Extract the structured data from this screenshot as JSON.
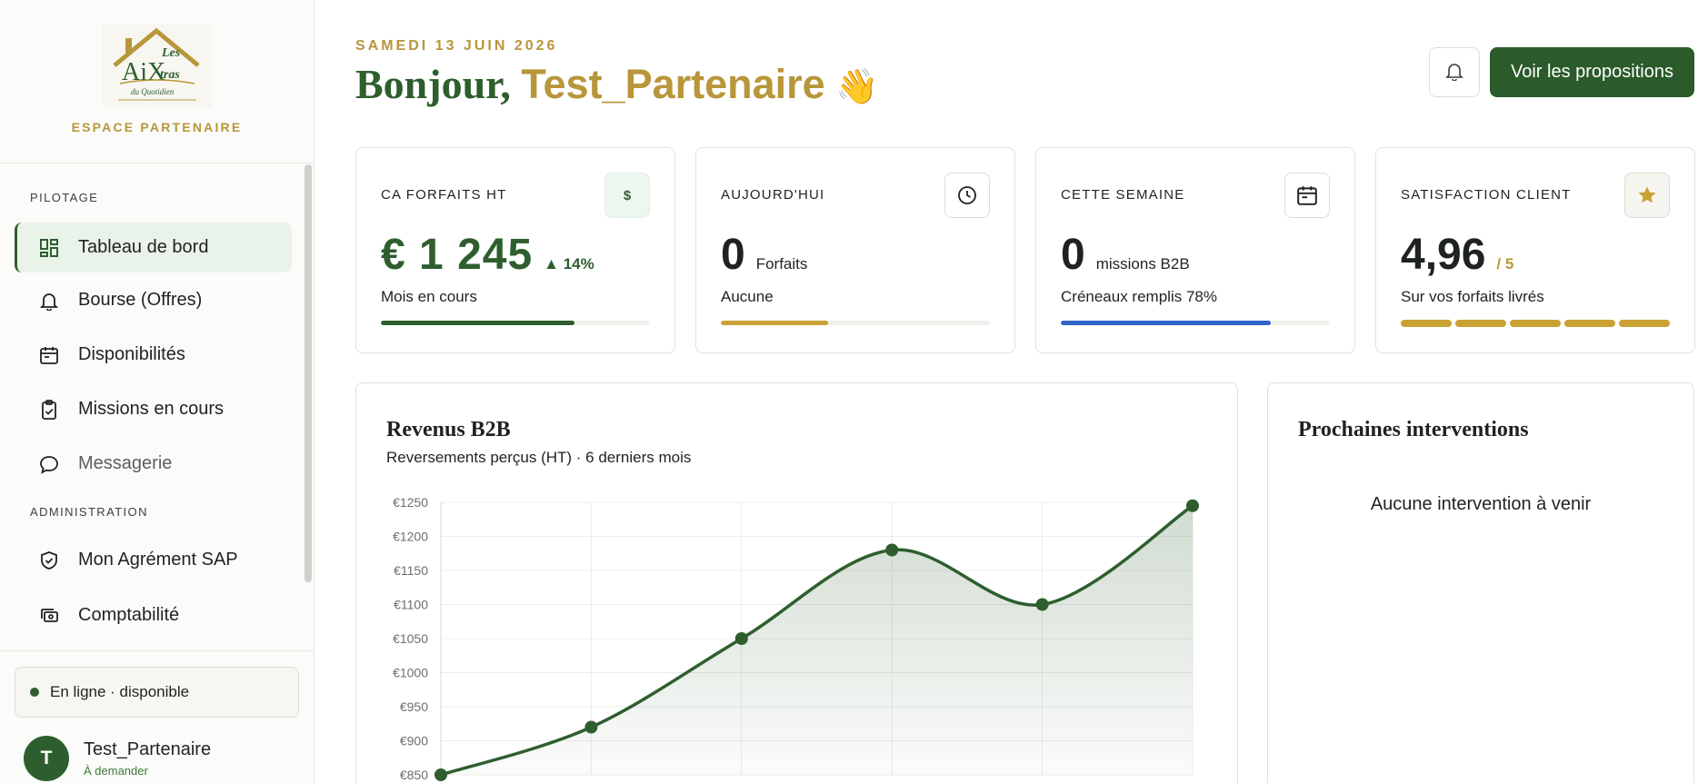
{
  "sidebar": {
    "brand_label": "ESPACE PARTENAIRE",
    "logo": {
      "top": "Les",
      "main": "AiX",
      "tail": "tras",
      "script": "du Quotidien"
    },
    "sections": [
      {
        "title": "PILOTAGE"
      },
      {
        "title": "ADMINISTRATION"
      }
    ],
    "items": [
      {
        "label": "Tableau de bord",
        "icon": "dashboard-icon"
      },
      {
        "label": "Bourse (Offres)",
        "icon": "bell-icon"
      },
      {
        "label": "Disponibilités",
        "icon": "calendar-icon"
      },
      {
        "label": "Missions en cours",
        "icon": "clipboard-check-icon"
      },
      {
        "label": "Messagerie",
        "icon": "chat-bubble-icon"
      },
      {
        "label": "Mon Agrément SAP",
        "icon": "shield-check-icon"
      },
      {
        "label": "Comptabilité",
        "icon": "cash-icon"
      }
    ],
    "status": "En ligne · disponible",
    "user": {
      "initial": "T",
      "name": "Test_Partenaire",
      "sub": "À demander"
    }
  },
  "header": {
    "date": "SAMEDI 13 JUIN 2026",
    "greeting": "Bonjour,",
    "name": "Test_Partenaire",
    "wave": "👋",
    "cta": "Voir les propositions"
  },
  "kpis": [
    {
      "title": "CA FORFAITS HT",
      "icon": "$",
      "value": "€ 1 245",
      "trend": "▲ 14%",
      "sub": "Mois en cours",
      "progress": 0.72,
      "color": "#2e5e2e"
    },
    {
      "title": "AUJOURD'HUI",
      "value": "0",
      "unit": "Forfaits",
      "sub": "Aucune",
      "progress": 0.4,
      "color": "#c9a233"
    },
    {
      "title": "CETTE SEMAINE",
      "value": "0",
      "unit": "missions B2B",
      "sub": "Créneaux remplis 78%",
      "progress": 0.78,
      "color": "#2f64c8"
    },
    {
      "title": "SATISFACTION CLIENT",
      "value": "4,96",
      "of": "/ 5",
      "sub": "Sur vos forfaits livrés",
      "rating": 4.96,
      "max": 5
    }
  ],
  "revenue": {
    "title": "Revenus B2B",
    "subtitle": "Reversements perçus (HT) · 6 derniers mois"
  },
  "upcoming": {
    "title": "Prochaines interventions",
    "empty": "Aucune intervention à venir"
  },
  "chart_data": {
    "type": "area",
    "x": [
      0,
      1,
      2,
      3,
      4,
      5
    ],
    "values": [
      850,
      920,
      1050,
      1180,
      1100,
      1245
    ],
    "ylim": [
      850,
      1250
    ],
    "yticks": [
      "€1250",
      "€1200",
      "€1150",
      "€1100",
      "€1050",
      "€1000",
      "€950",
      "€900",
      "€850"
    ],
    "ytick_values": [
      1250,
      1200,
      1150,
      1100,
      1050,
      1000,
      950,
      900,
      850
    ],
    "grid": true,
    "color": "#2e5e2e"
  }
}
